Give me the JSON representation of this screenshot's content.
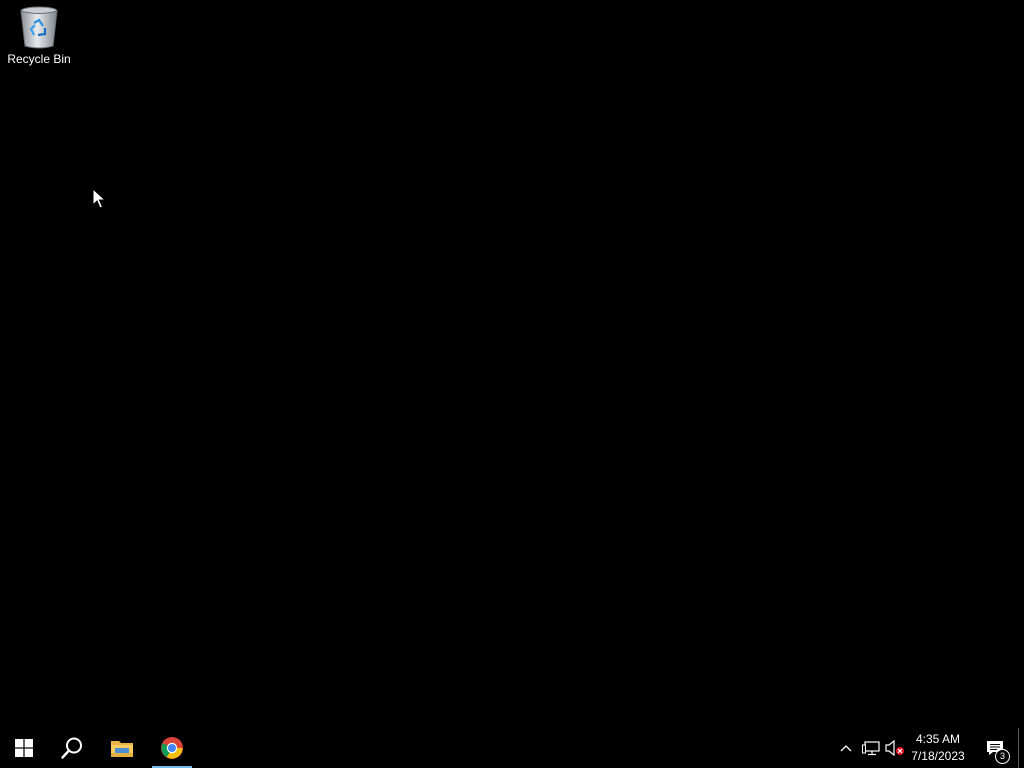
{
  "desktop": {
    "background_color": "#000000",
    "icons": [
      {
        "label": "Recycle Bin",
        "icon": "recycle-bin-icon"
      }
    ]
  },
  "taskbar": {
    "background_color": "#000000",
    "pinned": [
      {
        "name": "Start",
        "icon": "windows-logo-icon"
      },
      {
        "name": "Search",
        "icon": "search-icon"
      },
      {
        "name": "File Explorer",
        "icon": "folder-icon"
      },
      {
        "name": "Google Chrome",
        "icon": "chrome-icon",
        "active": true
      }
    ],
    "active_indicator_color": "#76b9ed",
    "tray": {
      "icons": [
        "chevron-up-icon",
        "network-icon",
        "volume-muted-icon"
      ],
      "time": "4:35 AM",
      "date": "7/18/2023",
      "notification_count": "3"
    }
  }
}
